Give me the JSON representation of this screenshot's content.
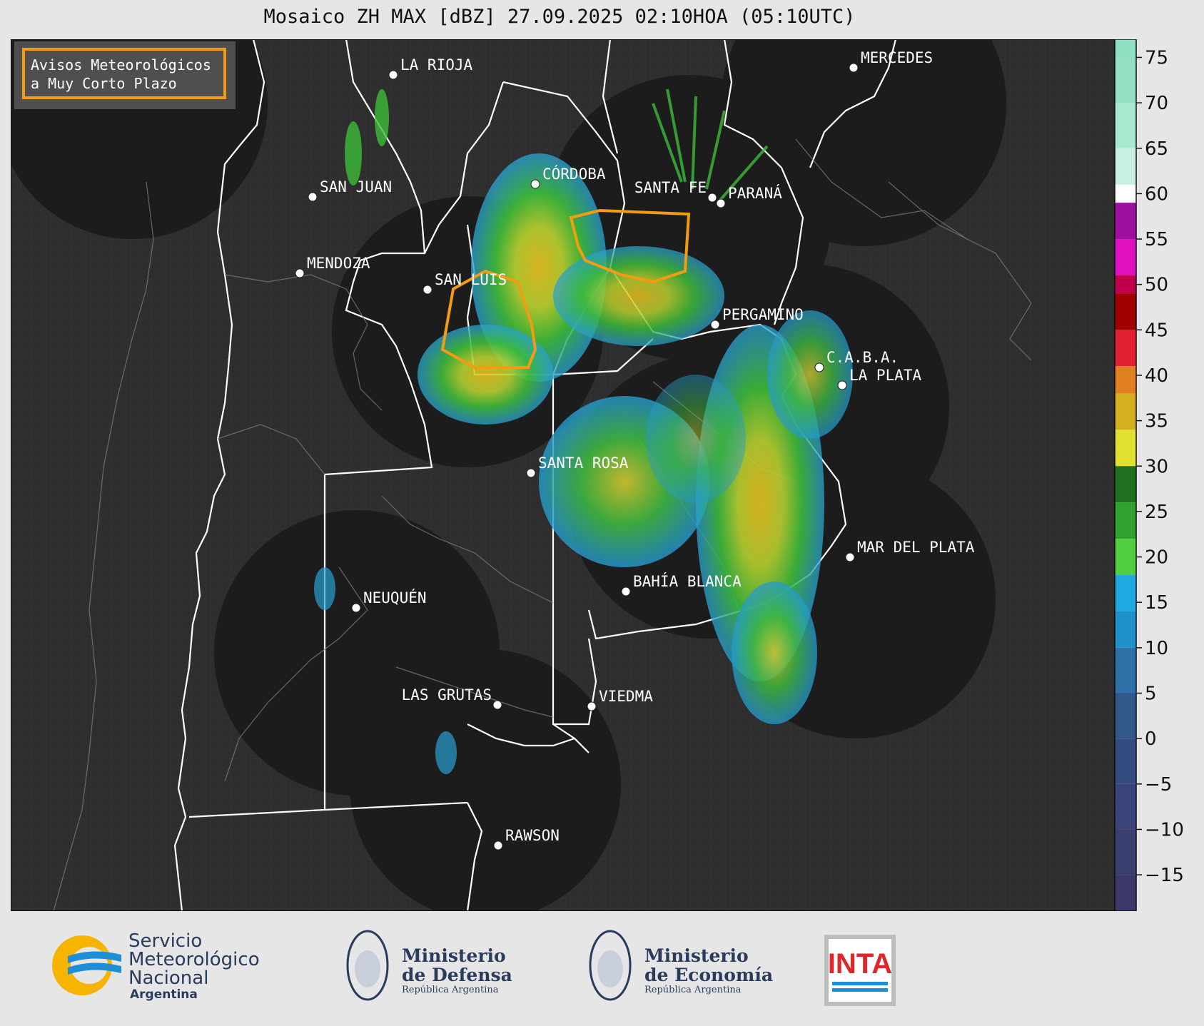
{
  "title": "Mosaico ZH MAX [dBZ] 27.09.2025 02:10HOA (05:10UTC)",
  "legend_box": {
    "line1": "Avisos Meteorológicos",
    "line2": "a Muy Corto Plazo",
    "color": "#f39c12"
  },
  "colors": {
    "background": "#2e2e2e",
    "radar_disk": "#1c1c1c",
    "border": "#ffffff",
    "warning": "#f39c12"
  },
  "cities": [
    {
      "name": "LA RIOJA"
    },
    {
      "name": "CÓRDOBA"
    },
    {
      "name": "SANTA FE"
    },
    {
      "name": "PARANÁ"
    },
    {
      "name": "MERCEDES"
    },
    {
      "name": "SAN JUAN"
    },
    {
      "name": "MENDOZA"
    },
    {
      "name": "SAN LUIS"
    },
    {
      "name": "PERGAMINO"
    },
    {
      "name": "C.A.B.A."
    },
    {
      "name": "LA PLATA"
    },
    {
      "name": "SANTA ROSA"
    },
    {
      "name": "MAR DEL PLATA"
    },
    {
      "name": "BAHÍA BLANCA"
    },
    {
      "name": "NEUQUÉN"
    },
    {
      "name": "LAS GRUTAS"
    },
    {
      "name": "VIEDMA"
    },
    {
      "name": "RAWSON"
    }
  ],
  "colorbar": {
    "ticks": [
      "75",
      "70",
      "65",
      "60",
      "55",
      "50",
      "45",
      "40",
      "35",
      "30",
      "25",
      "20",
      "15",
      "10",
      "5",
      "0",
      "−5",
      "−10",
      "−15"
    ],
    "min": -19,
    "max": 77
  },
  "logos": {
    "smn": {
      "line1": "Servicio",
      "line2": "Meteorológico",
      "line3": "Nacional",
      "line4": "Argentina"
    },
    "defensa": {
      "line1": "Ministerio",
      "line2": "de Defensa",
      "line3": "República Argentina"
    },
    "economia": {
      "line1": "Ministerio",
      "line2": "de Economía",
      "line3": "República Argentina"
    },
    "inta": {
      "text": "INTA"
    }
  }
}
